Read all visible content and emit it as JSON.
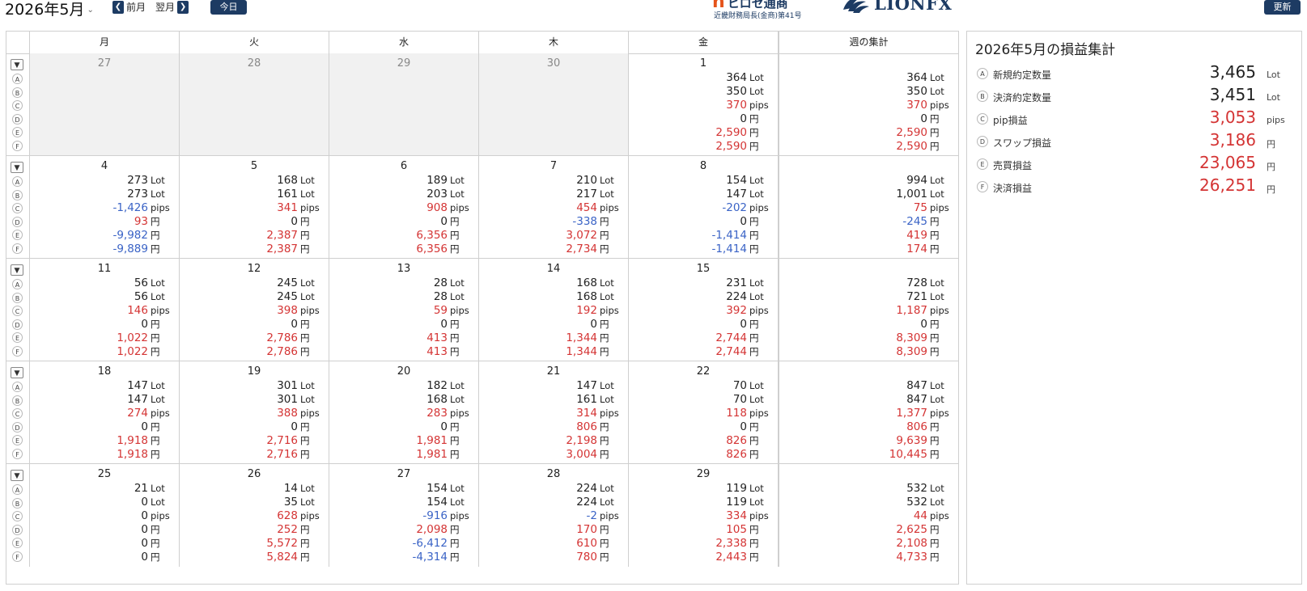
{
  "header": {
    "month_title": "2026年5月",
    "caret_icon": "chevron-down-icon",
    "prev_label": "前月",
    "next_label": "翌月",
    "today_label": "今日",
    "update_label": "更新",
    "hirose_mark": "h",
    "hirose_name": "ヒロセ通商",
    "hirose_sub": "近畿財務局長(金商)第41号",
    "lion_brand": "LIONFX",
    "accent_color": "#1d3b63"
  },
  "calendar": {
    "days_header": [
      "月",
      "火",
      "水",
      "木",
      "金",
      "週の集計"
    ],
    "row_letters": [
      "A",
      "B",
      "C",
      "D",
      "E",
      "F"
    ],
    "units": [
      "Lot",
      "Lot",
      "pips",
      "円",
      "円",
      "円"
    ],
    "weeks": [
      {
        "days": [
          {
            "d": "27",
            "other": true,
            "v": null
          },
          {
            "d": "28",
            "other": true,
            "v": null
          },
          {
            "d": "29",
            "other": true,
            "v": null
          },
          {
            "d": "30",
            "other": true,
            "v": null
          },
          {
            "d": "1",
            "other": false,
            "v": [
              "364",
              "350",
              "370",
              "0",
              "2,590",
              "2,590"
            ]
          }
        ],
        "total": [
          "364",
          "350",
          "370",
          "0",
          "2,590",
          "2,590"
        ]
      },
      {
        "days": [
          {
            "d": "4",
            "other": false,
            "v": [
              "273",
              "273",
              "-1,426",
              "93",
              "-9,982",
              "-9,889"
            ]
          },
          {
            "d": "5",
            "other": false,
            "v": [
              "168",
              "161",
              "341",
              "0",
              "2,387",
              "2,387"
            ]
          },
          {
            "d": "6",
            "other": false,
            "v": [
              "189",
              "203",
              "908",
              "0",
              "6,356",
              "6,356"
            ]
          },
          {
            "d": "7",
            "other": false,
            "v": [
              "210",
              "217",
              "454",
              "-338",
              "3,072",
              "2,734"
            ]
          },
          {
            "d": "8",
            "other": false,
            "v": [
              "154",
              "147",
              "-202",
              "0",
              "-1,414",
              "-1,414"
            ]
          }
        ],
        "total": [
          "994",
          "1,001",
          "75",
          "-245",
          "419",
          "174"
        ]
      },
      {
        "days": [
          {
            "d": "11",
            "other": false,
            "v": [
              "56",
              "56",
              "146",
              "0",
              "1,022",
              "1,022"
            ]
          },
          {
            "d": "12",
            "other": false,
            "v": [
              "245",
              "245",
              "398",
              "0",
              "2,786",
              "2,786"
            ]
          },
          {
            "d": "13",
            "other": false,
            "v": [
              "28",
              "28",
              "59",
              "0",
              "413",
              "413"
            ]
          },
          {
            "d": "14",
            "other": false,
            "v": [
              "168",
              "168",
              "192",
              "0",
              "1,344",
              "1,344"
            ]
          },
          {
            "d": "15",
            "other": false,
            "v": [
              "231",
              "224",
              "392",
              "0",
              "2,744",
              "2,744"
            ]
          }
        ],
        "total": [
          "728",
          "721",
          "1,187",
          "0",
          "8,309",
          "8,309"
        ]
      },
      {
        "days": [
          {
            "d": "18",
            "other": false,
            "v": [
              "147",
              "147",
              "274",
              "0",
              "1,918",
              "1,918"
            ]
          },
          {
            "d": "19",
            "other": false,
            "v": [
              "301",
              "301",
              "388",
              "0",
              "2,716",
              "2,716"
            ]
          },
          {
            "d": "20",
            "other": false,
            "v": [
              "182",
              "168",
              "283",
              "0",
              "1,981",
              "1,981"
            ]
          },
          {
            "d": "21",
            "other": false,
            "v": [
              "147",
              "161",
              "314",
              "806",
              "2,198",
              "3,004"
            ]
          },
          {
            "d": "22",
            "other": false,
            "v": [
              "70",
              "70",
              "118",
              "0",
              "826",
              "826"
            ]
          }
        ],
        "total": [
          "847",
          "847",
          "1,377",
          "806",
          "9,639",
          "10,445"
        ]
      },
      {
        "days": [
          {
            "d": "25",
            "other": false,
            "v": [
              "21",
              "0",
              "0",
              "0",
              "0",
              "0"
            ]
          },
          {
            "d": "26",
            "other": false,
            "v": [
              "14",
              "35",
              "628",
              "252",
              "5,572",
              "5,824"
            ]
          },
          {
            "d": "27",
            "other": false,
            "v": [
              "154",
              "154",
              "-916",
              "2,098",
              "-6,412",
              "-4,314"
            ]
          },
          {
            "d": "28",
            "other": false,
            "v": [
              "224",
              "224",
              "-2",
              "170",
              "610",
              "780"
            ]
          },
          {
            "d": "29",
            "other": false,
            "v": [
              "119",
              "119",
              "334",
              "105",
              "2,338",
              "2,443"
            ]
          }
        ],
        "total": [
          "532",
          "532",
          "44",
          "2,625",
          "2,108",
          "4,733"
        ]
      }
    ]
  },
  "summary": {
    "title": "2026年5月の損益集計",
    "rows": [
      {
        "letter": "A",
        "label": "新規約定数量",
        "value": "3,465",
        "unit": "Lot",
        "kind": "zero"
      },
      {
        "letter": "B",
        "label": "決済約定数量",
        "value": "3,451",
        "unit": "Lot",
        "kind": "zero"
      },
      {
        "letter": "C",
        "label": "pip損益",
        "value": "3,053",
        "unit": "pips",
        "kind": "pos"
      },
      {
        "letter": "D",
        "label": "スワップ損益",
        "value": "3,186",
        "unit": "円",
        "kind": "pos"
      },
      {
        "letter": "E",
        "label": "売買損益",
        "value": "23,065",
        "unit": "円",
        "kind": "pos"
      },
      {
        "letter": "F",
        "label": "決済損益",
        "value": "26,251",
        "unit": "円",
        "kind": "pos"
      }
    ]
  },
  "colors": {
    "positive": "#d43434",
    "negative": "#3a63c6",
    "neutral": "#222222"
  }
}
